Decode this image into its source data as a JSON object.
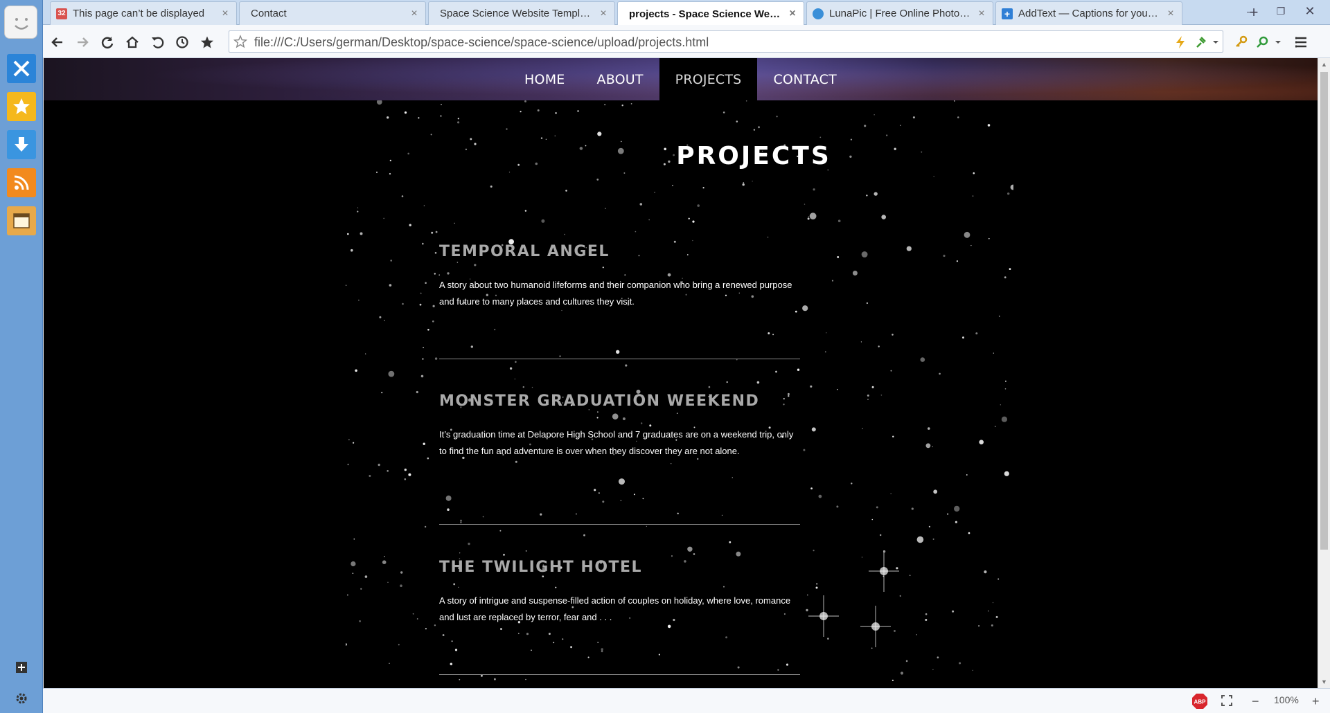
{
  "browser": {
    "tabs": [
      {
        "title": "This page can’t be displayed",
        "favicon": "calendar-icon",
        "badge": "32",
        "active": false
      },
      {
        "title": "Contact",
        "favicon": "none",
        "active": false
      },
      {
        "title": "Space Science Website Template...",
        "favicon": "none",
        "active": false
      },
      {
        "title": "projects - Space Science Websi...",
        "favicon": "none",
        "active": true
      },
      {
        "title": "LunaPic | Free Online Photo Ed...",
        "favicon": "lunapic-icon",
        "active": false
      },
      {
        "title": "AddText — Captions for your ...",
        "favicon": "addtext-icon",
        "active": false
      }
    ],
    "url": "file:///C:/Users/german/Desktop/space-science/space-science/upload/projects.html",
    "zoom": "100%"
  },
  "site": {
    "nav": [
      "HOME",
      "ABOUT",
      "PROJECTS",
      "CONTACT"
    ],
    "active_nav": "PROJECTS",
    "page_title": "PROJECTS",
    "projects": [
      {
        "title": "TEMPORAL ANGEL",
        "description": "A story about two humanoid lifeforms and their companion who bring a renewed purpose and future to many places and cultures they visit."
      },
      {
        "title": "MONSTER GRADUATION WEEKEND",
        "description": "It’s graduation time at Delapore High School and 7 graduates are on a weekend trip, only to find the fun and adventure is over when they discover they are not alone."
      },
      {
        "title": "THE TWILIGHT HOTEL",
        "description": "A story of intrigue and suspense-filled action of couples on holiday, where love, romance and lust are replaced by terror, fear and . . ."
      }
    ]
  }
}
